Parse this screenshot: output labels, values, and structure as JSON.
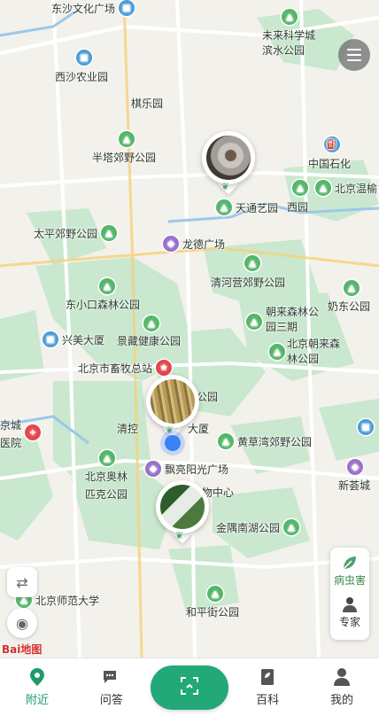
{
  "map": {
    "pois": [
      {
        "name": "东沙文化广场",
        "kind": "blue",
        "icon": "building-icon"
      },
      {
        "name": "未来科学城滨水公园",
        "kind": "green",
        "icon": "park-icon"
      },
      {
        "name": "西沙农业园",
        "kind": "blue",
        "icon": "building-icon"
      },
      {
        "name": "棋乐园",
        "kind": "none"
      },
      {
        "name": "半塔郊野公园",
        "kind": "green",
        "icon": "park-icon"
      },
      {
        "name": "中国石化",
        "kind": "blue",
        "icon": "fuel-icon"
      },
      {
        "name": "北京温榆",
        "kind": "green",
        "icon": "park-icon"
      },
      {
        "name": "西园",
        "kind": "green",
        "icon": "park-icon"
      },
      {
        "name": "天通艺园",
        "kind": "green",
        "icon": "park-icon"
      },
      {
        "name": "太平郊野公园",
        "kind": "green",
        "icon": "park-icon"
      },
      {
        "name": "龙德广场",
        "kind": "purple",
        "icon": "shopping-icon"
      },
      {
        "name": "清河营郊野公园",
        "kind": "green",
        "icon": "park-icon"
      },
      {
        "name": "东小口森林公园",
        "kind": "green",
        "icon": "park-icon"
      },
      {
        "name": "奶东公园",
        "kind": "green",
        "icon": "park-icon"
      },
      {
        "name": "朝来森林公园三期",
        "kind": "green",
        "icon": "park-icon"
      },
      {
        "name": "兴美大厦",
        "kind": "blue",
        "icon": "building-icon"
      },
      {
        "name": "景藏健康公园",
        "kind": "green",
        "icon": "park-icon"
      },
      {
        "name": "北京朝来森林公园",
        "kind": "green",
        "icon": "park-icon"
      },
      {
        "name": "北京市畜牧总站",
        "kind": "red",
        "icon": "star-icon"
      },
      {
        "name": "公园",
        "kind": "none"
      },
      {
        "name": "京城医院",
        "kind": "red",
        "icon": "hospital-icon"
      },
      {
        "name": "清控",
        "kind": "none"
      },
      {
        "name": "大厦",
        "kind": "none"
      },
      {
        "name": "黄草湾郊野公园",
        "kind": "green",
        "icon": "park-icon"
      },
      {
        "name": "北京奥林匹克公园",
        "kind": "green",
        "icon": "park-icon"
      },
      {
        "name": "飘亮阳光广场",
        "kind": "purple",
        "icon": "shopping-icon"
      },
      {
        "name": "物中心",
        "kind": "none"
      },
      {
        "name": "新荟城",
        "kind": "purple",
        "icon": "shopping-icon"
      },
      {
        "name": "金隅南湖公园",
        "kind": "green",
        "icon": "park-icon"
      },
      {
        "name": "北京师范大学",
        "kind": "green",
        "icon": "school-icon"
      },
      {
        "name": "和平街公园",
        "kind": "green",
        "icon": "park-icon"
      }
    ],
    "attribution": "Bai地图"
  },
  "side_panel": {
    "pest_label": "病虫害",
    "expert_label": "专家"
  },
  "tabbar": {
    "tabs": [
      {
        "label": "附近",
        "icon": "location-pin-icon",
        "active": true
      },
      {
        "label": "问答",
        "icon": "chat-bubble-icon",
        "active": false
      },
      {
        "label": "",
        "icon": "scan-icon",
        "active": false
      },
      {
        "label": "百科",
        "icon": "book-icon",
        "active": false
      },
      {
        "label": "我的",
        "icon": "user-icon",
        "active": false
      }
    ]
  },
  "colors": {
    "accent": "#1f9b6b",
    "park": "#55b66a",
    "map_bg": "#f3f1ec",
    "green_area": "#bfe3c7",
    "road": "#ffffff",
    "water": "#9cc8ea"
  }
}
